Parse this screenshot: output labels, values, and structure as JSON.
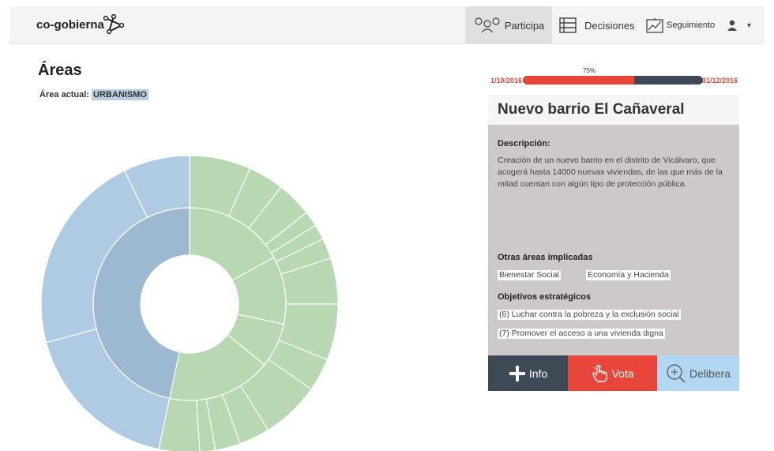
{
  "header": {
    "brand": "co-gobierna",
    "nav": [
      {
        "label": "Participa",
        "icon": "people-icon",
        "active": true
      },
      {
        "label": "Decisiones",
        "icon": "list-icon",
        "active": false
      },
      {
        "label": "Seguimiento",
        "icon": "chart-trend-icon",
        "active": false
      }
    ],
    "user_icon": "user-icon"
  },
  "main": {
    "title": "Áreas",
    "current_area_label": "Área actual:",
    "current_area_value": "URBANISMO"
  },
  "timeline": {
    "start": "1/10/2016",
    "end": "31/12/2016",
    "progress_label": "75%",
    "progress": 0.62
  },
  "project": {
    "title": "Nuevo barrio El Cañaveral",
    "description_label": "Descripción:",
    "description": "Creación de un nuevo barrio en el distrito de Vicálvaro, que acogerá hasta 14000 nuevas viviendas, de las que más de la mitad cuentan con algún tipo de protección pública.",
    "other_areas_label": "Otras áreas implicadas",
    "other_areas": [
      "Bienestar Social",
      "Economía y Hacienda"
    ],
    "objectives_label": "Objetivos estratégicos",
    "objectives": [
      "(6) Luchar contra la pobreza y la exclusión social",
      "(7) Promover el acceso a una vivienda digna"
    ]
  },
  "actions": {
    "info": "Info",
    "vota": "Vota",
    "delibera": "Delibera"
  },
  "colors": {
    "green": "#b7d8b0",
    "blue": "#aecbe3",
    "blue_selected": "#9db8d1",
    "red": "#e8463b",
    "dark": "#3d4a55",
    "light_blue": "#b2d7f2"
  }
}
